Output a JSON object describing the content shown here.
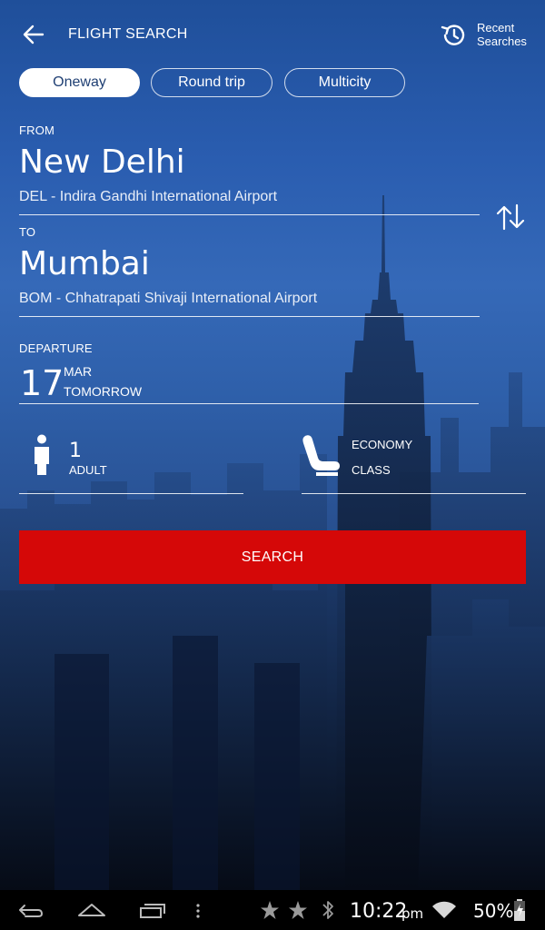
{
  "header": {
    "title": "FLIGHT SEARCH",
    "recent_line1": "Recent",
    "recent_line2": "Searches",
    "back_icon": "arrow-left-icon",
    "recent_icon": "history-icon"
  },
  "trip_types": [
    {
      "label": "Oneway",
      "selected": true
    },
    {
      "label": "Round trip",
      "selected": false
    },
    {
      "label": "Multicity",
      "selected": false
    }
  ],
  "from": {
    "label": "FROM",
    "city": "New Delhi",
    "airport": "DEL - Indira Gandhi International Airport"
  },
  "to": {
    "label": "TO",
    "city": "Mumbai",
    "airport": "BOM - Chhatrapati Shivaji International Airport"
  },
  "swap_icon": "swap-vertical-icon",
  "departure": {
    "label": "DEPARTURE",
    "day": "17",
    "month": "MAR",
    "relative": "TOMORROW"
  },
  "passengers": {
    "count": "1",
    "type": "ADULT",
    "icon": "person-icon"
  },
  "cabin": {
    "class": "ECONOMY",
    "label": "CLASS",
    "icon": "seat-icon"
  },
  "search_label": "SEARCH",
  "status_bar": {
    "time": "10:22",
    "ampm": "pm",
    "battery": "50%"
  },
  "colors": {
    "accent": "#d50808",
    "background": "#2a5db0"
  }
}
